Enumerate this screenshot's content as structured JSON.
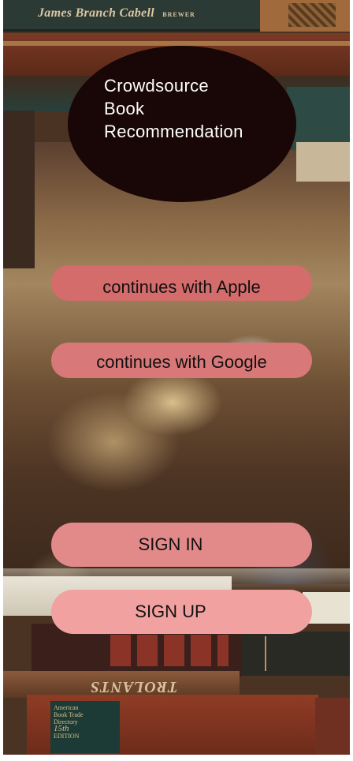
{
  "app": {
    "title_lines": [
      "Crowdsource",
      "Book",
      "Recommendation"
    ]
  },
  "auth": {
    "apple_label": "continues with Apple",
    "google_label": "continues with Google",
    "signin_label": "SIGN IN",
    "signup_label": "SIGN UP"
  },
  "background": {
    "spine_top_text": "James Branch Cabell",
    "spine_top_small": "BREWER",
    "spine_bottom_text": "TROLANTS",
    "label_text": [
      "American",
      "Book Trade",
      "Directory",
      "15th",
      "EDITION"
    ]
  },
  "colors": {
    "badge": "#190606",
    "apple_button": "#d46c6c",
    "google_button": "#d87878",
    "signin_button": "#e28a8a",
    "signup_button": "#f0a1a0"
  }
}
